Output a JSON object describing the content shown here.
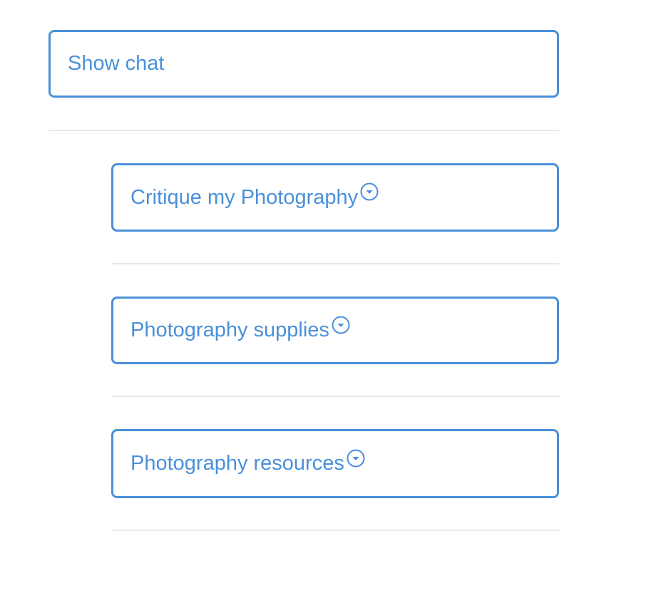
{
  "show_chat": {
    "label": "Show chat"
  },
  "categories": [
    {
      "label": "Critique my Photography",
      "icon": "chevron-down-circle-icon"
    },
    {
      "label": "Photography supplies",
      "icon": "chevron-down-circle-icon"
    },
    {
      "label": "Photography resources",
      "icon": "chevron-down-circle-icon"
    }
  ],
  "colors": {
    "accent": "#4a90d9",
    "divider": "#e8e8e8",
    "background": "#ffffff"
  }
}
